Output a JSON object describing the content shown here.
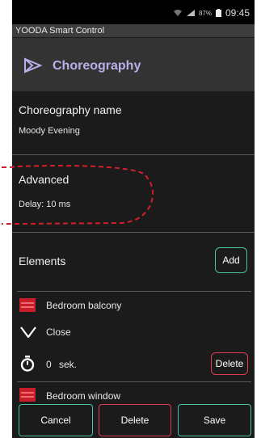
{
  "status_bar": {
    "battery": "87%",
    "time": "09:45"
  },
  "app": {
    "title": "YOODA Smart Control"
  },
  "header": {
    "title": "Choreography",
    "icon": "play-outline-icon"
  },
  "name_section": {
    "label": "Choreography name",
    "value": "Moody Evening"
  },
  "advanced": {
    "title": "Advanced",
    "delay": "Delay: 10 ms"
  },
  "elements": {
    "title": "Elements",
    "add_label": "Add",
    "items": [
      {
        "name": "Bedroom balcony",
        "icon": "blinds-icon",
        "action": "Close",
        "action_icon": "chevron-down-icon",
        "timer": "0",
        "timer_unit": "sek.",
        "delete_label": "Delete"
      },
      {
        "name": "Bedroom window",
        "icon": "blinds-icon"
      }
    ]
  },
  "footer": {
    "cancel": "Cancel",
    "delete": "Delete",
    "save": "Save"
  },
  "colors": {
    "accent_green": "#4cc1a2",
    "accent_red": "#e23b4f",
    "header_text": "#b8b0e8",
    "annotation": "#d21f2b"
  }
}
